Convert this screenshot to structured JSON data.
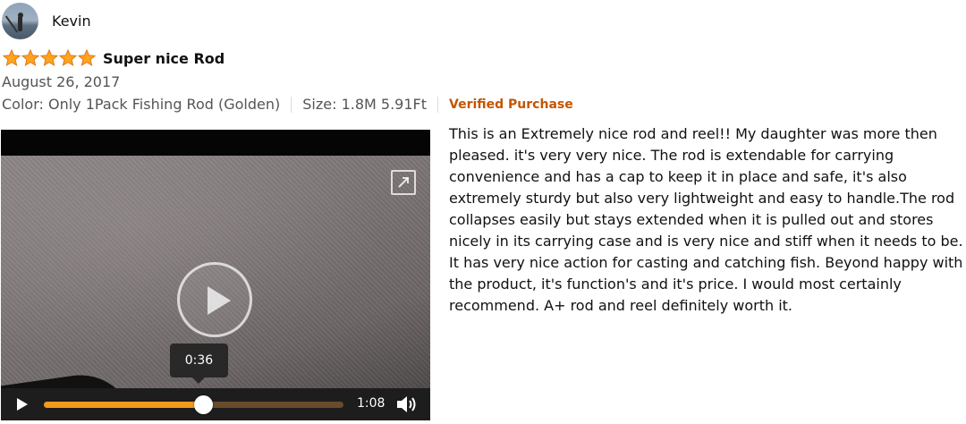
{
  "reviewer": {
    "name": "Kevin",
    "avatar_icon": "profile-photo-icon"
  },
  "review": {
    "rating": 5,
    "rating_max": 5,
    "star_color": "#ffa41c",
    "title": "Super nice Rod",
    "date": "August 26, 2017",
    "color_variant": "Color: Only 1Pack Fishing Rod (Golden)",
    "size_variant": "Size: 1.8M 5.91Ft",
    "verified_label": "Verified Purchase",
    "verified_color": "#c45500",
    "body": "This is an Extremely nice rod and reel!! My daughter was more then pleased. it's very very nice. The rod is extendable for carrying convenience and has a cap to keep it in place and safe, it's also extremely sturdy but also very lightweight and easy to handle.The rod collapses easily but stays extended when it is pulled out and stores nicely in its carrying case and is very nice and stiff when it needs to be. It has very nice action for casting and catching fish. Beyond happy with the product, it's function's and it's price. I would most certainly recommend. A+ rod and reel definitely worth it."
  },
  "video": {
    "hover_time": "0:36",
    "duration": "1:08",
    "progress_fraction": 0.53,
    "progress_color": "#f29a1a",
    "icons": {
      "expand": "expand-icon",
      "play_overlay": "play-icon",
      "play_control": "play-icon",
      "volume": "volume-icon"
    }
  }
}
